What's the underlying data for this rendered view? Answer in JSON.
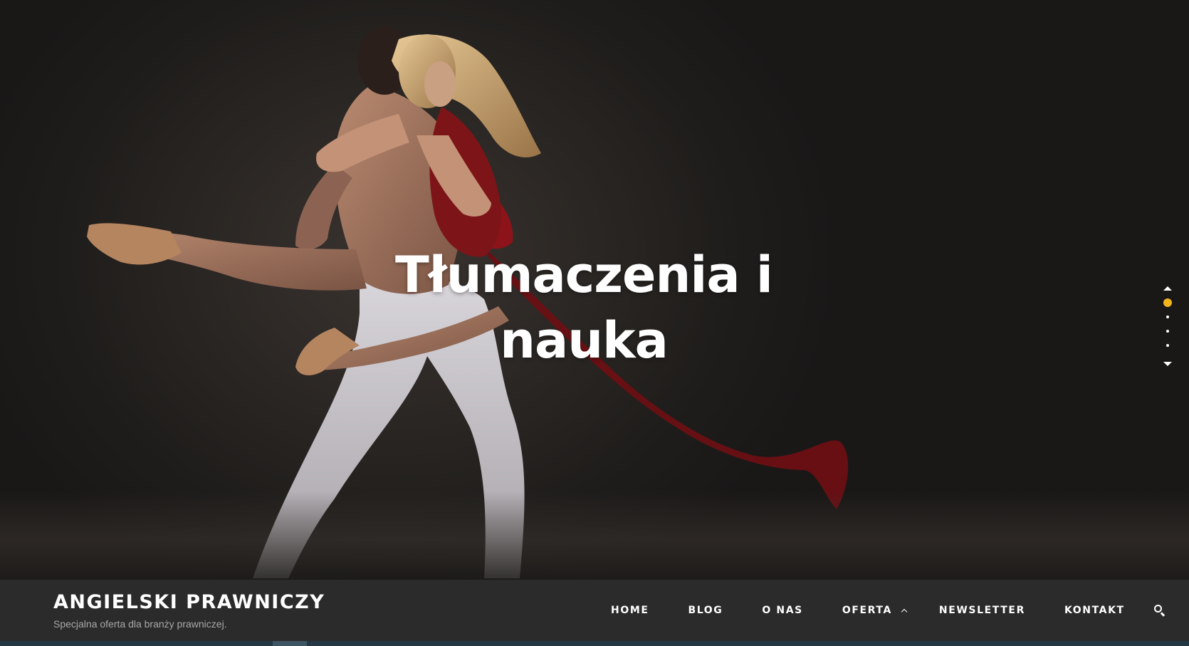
{
  "hero": {
    "title_line1": "Tłumaczenia i",
    "title_line2": "nauka",
    "background_image": "ballet-dancers-couple"
  },
  "slider": {
    "up_icon": "triangle-up-icon",
    "down_icon": "triangle-down-icon",
    "dot_count": 4,
    "active_index": 0,
    "active_color": "#f2b51d"
  },
  "header": {
    "site_title": "ANGIELSKI PRAWNICZY",
    "tagline": "Specjalna oferta dla branży prawniczej."
  },
  "nav": {
    "items": [
      {
        "label": "HOME"
      },
      {
        "label": "BLOG"
      },
      {
        "label": "O NAS"
      },
      {
        "label": "OFERTA",
        "has_submenu": true
      },
      {
        "label": "NEWSLETTER"
      },
      {
        "label": "KONTAKT"
      }
    ],
    "search_icon": "search-icon"
  },
  "colors": {
    "header_bg": "#2b2b2b",
    "hero_bg": "#1f1d1b",
    "accent": "#f2b51d",
    "text": "#ffffff"
  }
}
